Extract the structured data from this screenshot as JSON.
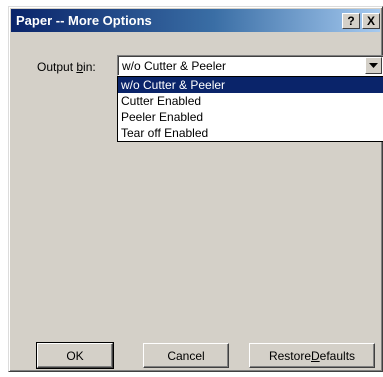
{
  "window": {
    "title": "Paper -- More Options",
    "help_button": "?",
    "close_button": "X"
  },
  "output_bin": {
    "label_prefix": "Output ",
    "label_underlined": "b",
    "label_suffix": "in:",
    "selected_value": "w/o Cutter & Peeler",
    "options": [
      "w/o Cutter & Peeler",
      "Cutter Enabled",
      "Peeler Enabled",
      "Tear off Enabled"
    ],
    "highlighted_index": 0
  },
  "buttons": {
    "ok": "OK",
    "cancel": "Cancel",
    "restore_prefix": "Restore ",
    "restore_underlined": "D",
    "restore_suffix": "efaults"
  },
  "colors": {
    "face": "#d4d0c8",
    "title_start": "#0a246a",
    "title_end": "#a6caf0",
    "highlight": "#0a246a"
  }
}
